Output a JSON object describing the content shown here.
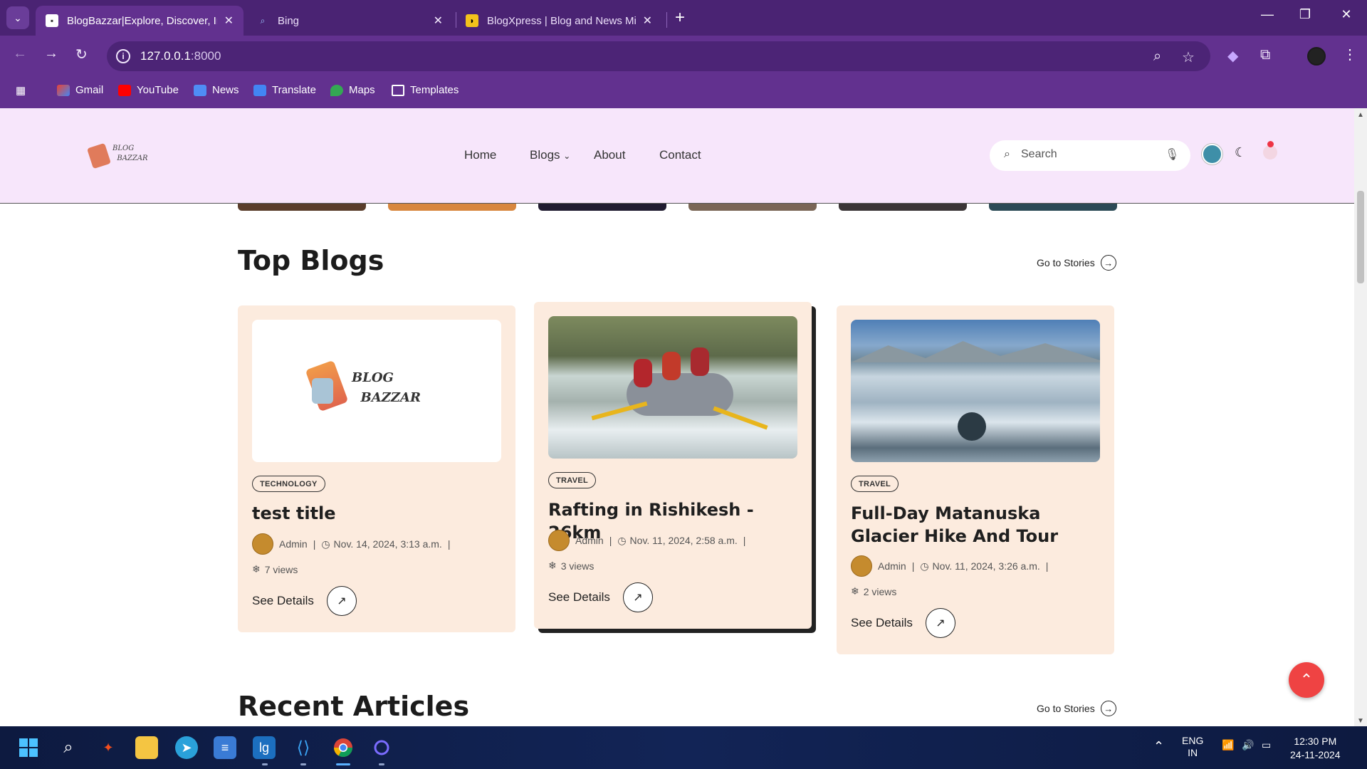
{
  "browser": {
    "tabs": [
      {
        "title": "BlogBazzar|Explore, Discover, In",
        "active": true
      },
      {
        "title": "Bing",
        "active": false
      },
      {
        "title": "BlogXpress | Blog and News Mi",
        "active": false
      }
    ],
    "url_host": "127.0.0.1",
    "url_port": ":8000",
    "bookmarks": [
      "Gmail",
      "YouTube",
      "News",
      "Translate",
      "Maps",
      "Templates"
    ]
  },
  "site": {
    "logo_line1": "BLOG",
    "logo_line2": "BAZZAR",
    "nav": {
      "home": "Home",
      "blogs": "Blogs",
      "about": "About",
      "contact": "Contact"
    },
    "search_placeholder": "Search"
  },
  "top_blogs": {
    "title": "Top Blogs",
    "goto": "Go to Stories",
    "cards": [
      {
        "category": "TECHNOLOGY",
        "title": "test title",
        "author": "Admin",
        "date": "Nov. 14, 2024, 3:13 a.m.",
        "views": "7 views",
        "cta": "See Details",
        "image_logo1": "BLOG",
        "image_logo2": "BAZZAR"
      },
      {
        "category": "TRAVEL",
        "title": "Rafting in Rishikesh - 26km",
        "author": "Admin",
        "date": "Nov. 11, 2024, 2:58 a.m.",
        "views": "3 views",
        "cta": "See Details"
      },
      {
        "category": "TRAVEL",
        "title": "Full-Day Matanuska Glacier Hike And Tour",
        "author": "Admin",
        "date": "Nov. 11, 2024, 3:26 a.m.",
        "views": "2 views",
        "cta": "See Details"
      }
    ]
  },
  "recent": {
    "title": "Recent Articles",
    "goto": "Go to Stories"
  },
  "taskbar": {
    "lang": "ENG",
    "region": "IN",
    "time": "12:30 PM",
    "date": "24-11-2024"
  },
  "colors": {
    "chrome": "#62318f",
    "header_bg": "#f7e6fb",
    "card_bg": "#fcebde",
    "highlight": "#a7eecb",
    "scroll_btn": "#ef4343"
  }
}
